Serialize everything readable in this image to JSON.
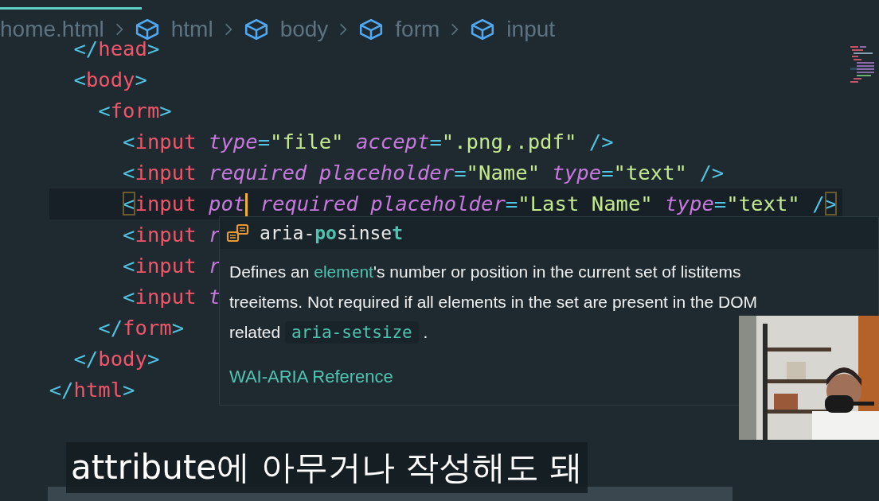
{
  "breadcrumb": {
    "items": [
      {
        "label": "home.html",
        "kind": "file"
      },
      {
        "label": "html",
        "kind": "element"
      },
      {
        "label": "body",
        "kind": "element"
      },
      {
        "label": "form",
        "kind": "element"
      },
      {
        "label": "input",
        "kind": "element"
      }
    ]
  },
  "editor": {
    "lines": [
      {
        "tokens": [
          {
            "kind": "punct",
            "text": "      </"
          },
          {
            "kind": "tag",
            "text": "head"
          },
          {
            "kind": "punct",
            "text": ">"
          }
        ]
      },
      {
        "tokens": [
          {
            "kind": "punct",
            "text": "      <"
          },
          {
            "kind": "tag",
            "text": "body"
          },
          {
            "kind": "punct",
            "text": ">"
          }
        ]
      },
      {
        "tokens": [
          {
            "kind": "punct",
            "text": "        <"
          },
          {
            "kind": "tag",
            "text": "form"
          },
          {
            "kind": "punct",
            "text": ">"
          }
        ]
      },
      {
        "tokens": [
          {
            "kind": "punct",
            "text": "          <"
          },
          {
            "kind": "tag",
            "text": "input"
          },
          {
            "kind": "attr",
            "text": " type"
          },
          {
            "kind": "punct",
            "text": "="
          },
          {
            "kind": "string",
            "text": "\"file\""
          },
          {
            "kind": "attr",
            "text": " accept"
          },
          {
            "kind": "punct",
            "text": "="
          },
          {
            "kind": "string",
            "text": "\".png,.pdf\""
          },
          {
            "kind": "punct",
            "text": " />"
          }
        ]
      },
      {
        "tokens": [
          {
            "kind": "punct",
            "text": "          <"
          },
          {
            "kind": "tag",
            "text": "input"
          },
          {
            "kind": "attr",
            "text": " required"
          },
          {
            "kind": "attr",
            "text": " placeholder"
          },
          {
            "kind": "punct",
            "text": "="
          },
          {
            "kind": "string",
            "text": "\"Name\""
          },
          {
            "kind": "attr",
            "text": " type"
          },
          {
            "kind": "punct",
            "text": "="
          },
          {
            "kind": "string",
            "text": "\"text\""
          },
          {
            "kind": "punct",
            "text": " />"
          }
        ]
      },
      {
        "tokens": [
          {
            "kind": "punct",
            "text": "          <",
            "matched": true
          },
          {
            "kind": "tag",
            "text": "input"
          },
          {
            "kind": "attr",
            "text": " pot"
          },
          {
            "kind": "caret"
          },
          {
            "kind": "attr",
            "text": " required"
          },
          {
            "kind": "attr",
            "text": " placeholder"
          },
          {
            "kind": "punct",
            "text": "="
          },
          {
            "kind": "string",
            "text": "\"Last Name\""
          },
          {
            "kind": "attr",
            "text": " type"
          },
          {
            "kind": "punct",
            "text": "="
          },
          {
            "kind": "string",
            "text": "\"text\""
          },
          {
            "kind": "punct",
            "text": " /"
          },
          {
            "kind": "punct",
            "text": ">",
            "matched": true
          }
        ]
      },
      {
        "tokens": [
          {
            "kind": "punct",
            "text": "          <"
          },
          {
            "kind": "tag",
            "text": "input"
          },
          {
            "kind": "attr",
            "text": " r"
          }
        ]
      },
      {
        "tokens": [
          {
            "kind": "punct",
            "text": "          <"
          },
          {
            "kind": "tag",
            "text": "input"
          },
          {
            "kind": "attr",
            "text": " r"
          }
        ]
      },
      {
        "tokens": [
          {
            "kind": "punct",
            "text": "          <"
          },
          {
            "kind": "tag",
            "text": "input"
          },
          {
            "kind": "attr",
            "text": " t"
          }
        ]
      },
      {
        "tokens": [
          {
            "kind": "punct",
            "text": "        </"
          },
          {
            "kind": "tag",
            "text": "form"
          },
          {
            "kind": "punct",
            "text": ">"
          }
        ]
      },
      {
        "tokens": [
          {
            "kind": "punct",
            "text": "      </"
          },
          {
            "kind": "tag",
            "text": "body"
          },
          {
            "kind": "punct",
            "text": ">"
          }
        ]
      },
      {
        "tokens": [
          {
            "kind": "punct",
            "text": "    </"
          },
          {
            "kind": "tag",
            "text": "html"
          },
          {
            "kind": "punct",
            "text": ">"
          }
        ]
      }
    ]
  },
  "suggestion": {
    "label": [
      {
        "text": "aria-",
        "matched": false
      },
      {
        "text": "po",
        "matched": true
      },
      {
        "text": "sinse",
        "matched": false
      },
      {
        "text": "t",
        "matched": true
      }
    ],
    "description_lines": [
      [
        {
          "text": "Defines an ",
          "kind": "plain"
        },
        {
          "text": "element",
          "kind": "link"
        },
        {
          "text": "'s number or position in the current set of listitems",
          "kind": "plain"
        }
      ],
      [
        {
          "text": "treeitems. Not required if all elements in the set are present in the DOM",
          "kind": "plain"
        }
      ],
      [
        {
          "text": "related ",
          "kind": "plain"
        },
        {
          "text": "aria-setsize",
          "kind": "code"
        },
        {
          "text": " .",
          "kind": "plain"
        }
      ]
    ],
    "reference_link": "WAI-ARIA Reference"
  },
  "subtitle": "attribute에 아무거나 작성해도 돼"
}
